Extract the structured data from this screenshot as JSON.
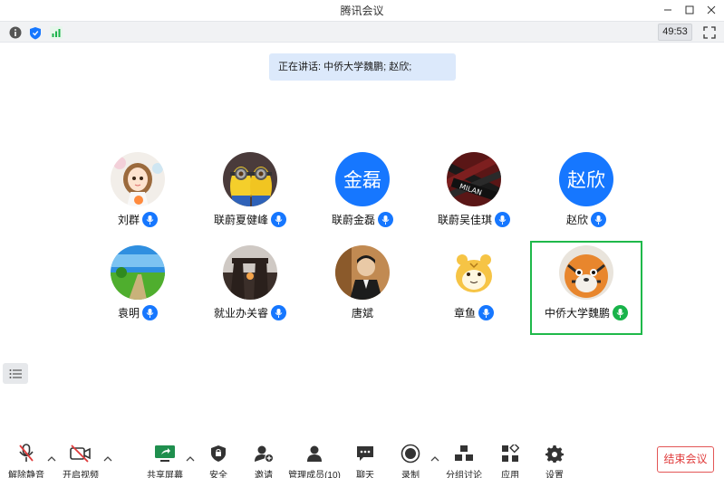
{
  "window": {
    "title": "腾讯会议"
  },
  "statusbar": {
    "timer": "49:53"
  },
  "speaking": {
    "text": "正在讲话: 中侨大学魏鹏; 赵欣;"
  },
  "participants": [
    {
      "name": "刘群",
      "avatar_text": "",
      "avatar": "cartoon-girl",
      "mic": "blue"
    },
    {
      "name": "联蔚夏健峰",
      "avatar_text": "",
      "avatar": "minions",
      "mic": "blue"
    },
    {
      "name": "联蔚金磊",
      "avatar_text": "金磊",
      "avatar": "text",
      "mic": "blue"
    },
    {
      "name": "联蔚吴佳琪",
      "avatar_text": "",
      "avatar": "milan-scarf",
      "mic": "blue"
    },
    {
      "name": "赵欣",
      "avatar_text": "赵欣",
      "avatar": "text",
      "mic": "blue"
    },
    {
      "name": "袁明",
      "avatar_text": "",
      "avatar": "landscape",
      "mic": "blue"
    },
    {
      "name": "就业办关睿",
      "avatar_text": "",
      "avatar": "sunset-rocks",
      "mic": "blue"
    },
    {
      "name": "唐斌",
      "avatar_text": "",
      "avatar": "person-photo",
      "mic": "none"
    },
    {
      "name": "章鱼",
      "avatar_text": "",
      "avatar": "tiger-cartoon",
      "mic": "blue"
    },
    {
      "name": "中侨大学魏鹏",
      "avatar_text": "",
      "avatar": "tiger-plush",
      "mic": "green"
    }
  ],
  "toolbar": {
    "unmute": "解除静音",
    "video": "开启视频",
    "share": "共享屏幕",
    "security": "安全",
    "invite": "邀请",
    "members": "管理成员(10)",
    "chat": "聊天",
    "record": "录制",
    "breakout": "分组讨论",
    "apps": "应用",
    "settings": "设置",
    "end": "结束会议"
  },
  "colors": {
    "accent": "#1677ff",
    "speaking_bg": "#dce9fb",
    "active_border": "#1fb94a",
    "end": "#e03b3b"
  }
}
